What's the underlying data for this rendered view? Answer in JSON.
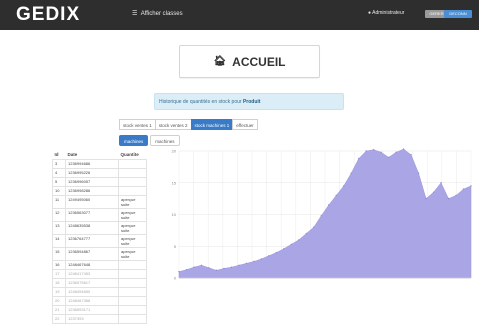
{
  "app": {
    "logo": "GEDIX",
    "nav_link": "Afficher classes",
    "user_link": "Administrateur",
    "btn_left": "GERER",
    "btn_right": "DECONN"
  },
  "header": {
    "title": "ACCUEIL"
  },
  "alert": {
    "text": "Historique de quantités en stock pour ",
    "product": "Produit"
  },
  "tabs": [
    {
      "label": "stock ventes 1",
      "active": false
    },
    {
      "label": "stock ventes 2",
      "active": false
    },
    {
      "label": "stock machines 1",
      "active": true
    },
    {
      "label": "effectuer",
      "active": false
    }
  ],
  "subtabs": [
    {
      "label": "machines",
      "active": true
    },
    {
      "label": "machines",
      "active": false
    }
  ],
  "table": {
    "columns": [
      "Id",
      "Date",
      "Quantite"
    ],
    "rows": [
      {
        "id": "3",
        "date": "1236994686",
        "qty": ""
      },
      {
        "id": "4",
        "date": "1236995226",
        "qty": ""
      },
      {
        "id": "5",
        "date": "1236996057",
        "qty": ""
      },
      {
        "id": "10",
        "date": "1236998286",
        "qty": ""
      },
      {
        "id": "11",
        "date": "1249495060",
        "qty": "aperçue suite"
      },
      {
        "id": "12",
        "date": "1236563077",
        "qty": "aperçue suite"
      },
      {
        "id": "13",
        "date": "1248635538",
        "qty": "aperçue suite"
      },
      {
        "id": "14",
        "date": "1236764777",
        "qty": "aperçue suite"
      },
      {
        "id": "15",
        "date": "1236594867",
        "qty": "aperçue suite"
      },
      {
        "id": "16",
        "date": "1248467648",
        "qty": ""
      },
      {
        "id": "17",
        "date": "1248417453",
        "qty": ""
      },
      {
        "id": "18",
        "date": "1236575617",
        "qty": ""
      },
      {
        "id": "19",
        "date": "1248494650",
        "qty": ""
      },
      {
        "id": "20",
        "date": "1248467366",
        "qty": ""
      },
      {
        "id": "21",
        "date": "1236593171",
        "qty": ""
      },
      {
        "id": "22",
        "date": "1237393",
        "qty": ""
      }
    ]
  },
  "chart_data": {
    "type": "area",
    "y_ticks": [
      "0",
      "5",
      "10",
      "15",
      "20"
    ],
    "ylim": [
      0,
      20
    ],
    "x_count": 40,
    "values": [
      1,
      1.3,
      1.7,
      2,
      1.6,
      1.2,
      1.5,
      1.7,
      2,
      2.3,
      2.6,
      3,
      3.5,
      4,
      4.6,
      5.3,
      6,
      7,
      8,
      9.8,
      11.5,
      13,
      14.5,
      16.5,
      18.8,
      20,
      20.2,
      19.8,
      19,
      19.8,
      20.3,
      19.4,
      16.5,
      12.5,
      13.5,
      15,
      12.5,
      13,
      14,
      14.5
    ],
    "fill": "#aaa5e4",
    "grid": true
  }
}
